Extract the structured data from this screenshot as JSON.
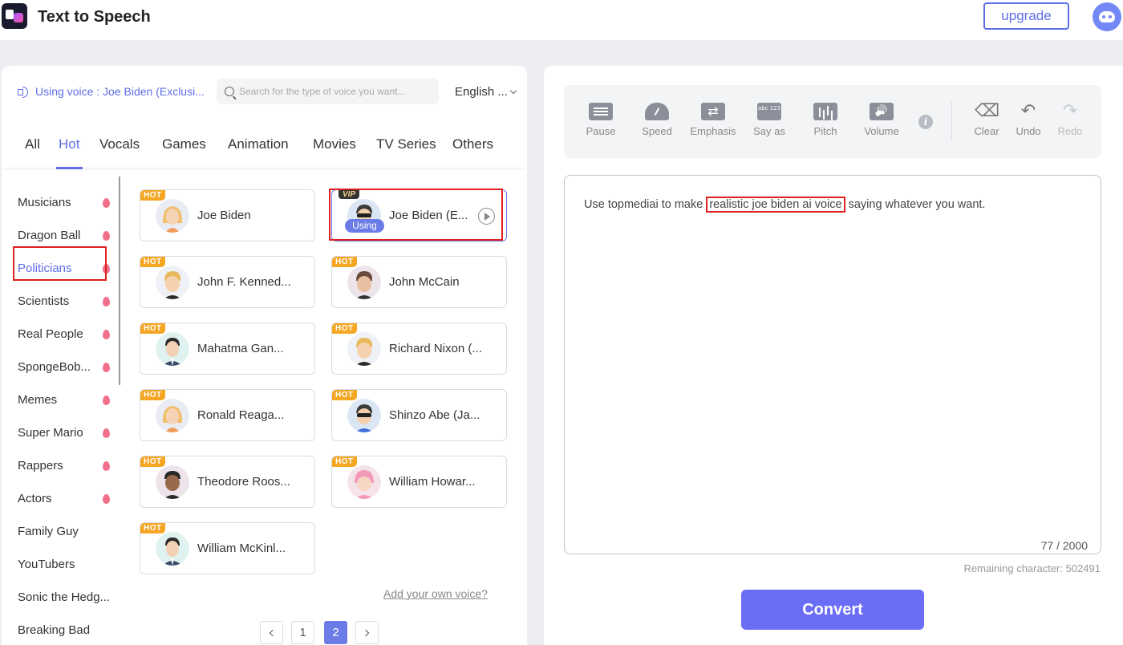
{
  "header": {
    "title": "Text to Speech",
    "upgrade_label": "upgrade"
  },
  "voice_bar": {
    "using_voice": "Using voice : Joe Biden (Exclusi...",
    "search_placeholder": "Search for the type of voice you want...",
    "language": "English ..."
  },
  "tabs": [
    "All",
    "Hot",
    "Vocals",
    "Games",
    "Animation",
    "Movies",
    "TV Series",
    "Others"
  ],
  "active_tab": "Hot",
  "categories": [
    {
      "label": "Musicians",
      "hot": true
    },
    {
      "label": "Dragon Ball",
      "hot": true
    },
    {
      "label": "Politicians",
      "hot": true
    },
    {
      "label": "Scientists",
      "hot": true
    },
    {
      "label": "Real People",
      "hot": true
    },
    {
      "label": "SpongeBob...",
      "hot": true
    },
    {
      "label": "Memes",
      "hot": true
    },
    {
      "label": "Super Mario",
      "hot": true
    },
    {
      "label": "Rappers",
      "hot": true
    },
    {
      "label": "Actors",
      "hot": true
    },
    {
      "label": "Family Guy",
      "hot": false
    },
    {
      "label": "YouTubers",
      "hot": false
    },
    {
      "label": "Sonic the Hedg...",
      "hot": false
    },
    {
      "label": "Breaking Bad",
      "hot": false
    }
  ],
  "active_category": "Politicians",
  "voices": [
    {
      "name": "Joe Biden",
      "tag": "HOT",
      "avatar": "blonde-woman"
    },
    {
      "name": "Joe Biden (E...",
      "tag": "VIP",
      "avatar": "sunglasses-man",
      "using": true,
      "using_label": "Using"
    },
    {
      "name": "John F. Kenned...",
      "tag": "HOT",
      "avatar": "blonde-man"
    },
    {
      "name": "John McCain",
      "tag": "HOT",
      "avatar": "dark-hair-man"
    },
    {
      "name": "Mahatma Gan...",
      "tag": "HOT",
      "avatar": "suit-man"
    },
    {
      "name": "Richard Nixon (...",
      "tag": "HOT",
      "avatar": "blonde-man"
    },
    {
      "name": "Ronald Reaga...",
      "tag": "HOT",
      "avatar": "blonde-woman"
    },
    {
      "name": "Shinzo Abe (Ja...",
      "tag": "HOT",
      "avatar": "sunglasses-man"
    },
    {
      "name": "Theodore Roos...",
      "tag": "HOT",
      "avatar": "dark-skin-man"
    },
    {
      "name": "William Howar...",
      "tag": "HOT",
      "avatar": "pink-hair"
    },
    {
      "name": "William McKinl...",
      "tag": "HOT",
      "avatar": "suit-man"
    }
  ],
  "add_voice_link": "Add your own voice?",
  "pagination": {
    "pages": [
      "1",
      "2"
    ],
    "current": "2"
  },
  "toolbar": {
    "pause": "Pause",
    "speed": "Speed",
    "emphasis": "Emphasis",
    "say_as": "Say as",
    "pitch": "Pitch",
    "volume": "Volume",
    "info": "i",
    "clear": "Clear",
    "undo": "Undo",
    "redo": "Redo"
  },
  "editor": {
    "text_before": "Use topmediai to make ",
    "text_highlight": "realistic joe biden ai voice",
    "text_after": " saying whatever you want.",
    "char_count": "77 / 2000"
  },
  "remaining": "Remaining character: 502491",
  "convert_label": "Convert",
  "colors": {
    "accent": "#6b7be8",
    "hot": "#f5a623",
    "highlight_box": "#e02020"
  }
}
